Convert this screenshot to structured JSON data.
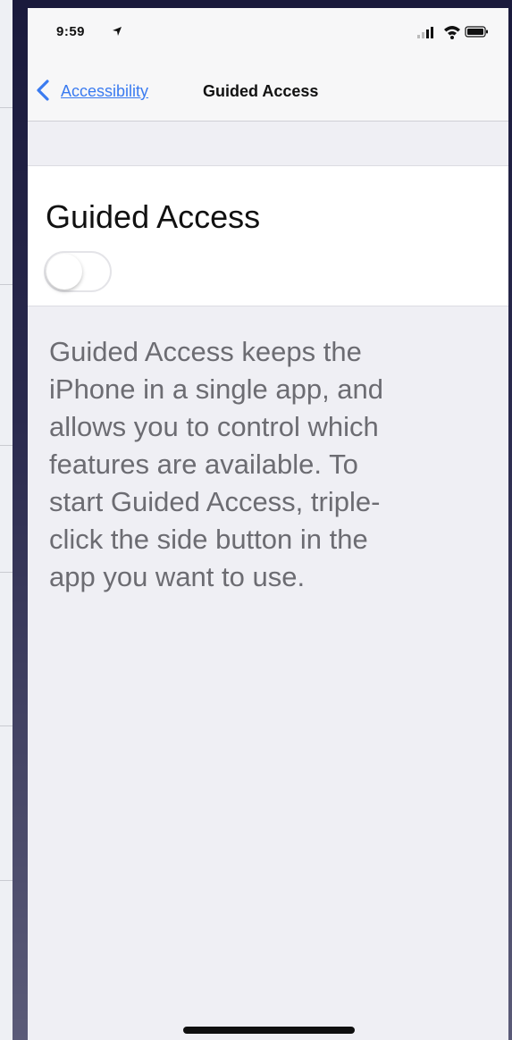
{
  "status_bar": {
    "time": "9:59",
    "icons": [
      "location-arrow-icon",
      "signal-icon",
      "wifi-icon",
      "battery-icon"
    ]
  },
  "nav": {
    "back_label": "Accessibility",
    "title": "Guided Access"
  },
  "setting": {
    "title": "Guided Access",
    "toggle_on": false,
    "description": "Guided Access keeps the\niPhone in a single app, and\nallows you to control which\nfeatures are available. To\nstart Guided Access, triple-\nclick the side button in the\napp you want to use."
  },
  "colors": {
    "link": "#3a7bf0",
    "background": "#efeff4",
    "description_text": "#6c6c72"
  }
}
